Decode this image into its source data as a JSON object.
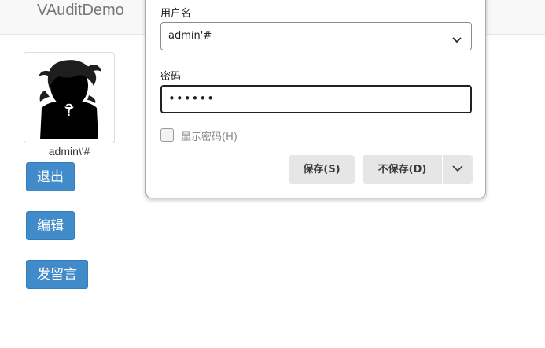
{
  "navbar": {
    "brand": "VAuditDemo"
  },
  "profile": {
    "avatar_glyph": "?",
    "username": "admin\\'#"
  },
  "actions": {
    "logout_label": "退出",
    "edit_label": "编辑",
    "post_label": "发留言"
  },
  "password_popup": {
    "username_label": "用户名",
    "username_value": "admin'#",
    "password_label": "密码",
    "password_value": "••••••",
    "show_password_label": "显示密码(H)",
    "save_label": "保存(S)",
    "no_save_label": "不保存(D)"
  },
  "colors": {
    "accent": "#428bca",
    "navbar_bg": "#f8f8f8",
    "popup_button_bg": "#e6e6e6"
  },
  "icons": {
    "username_dropdown": "chevron-down-icon",
    "more_options": "chevron-down-icon"
  }
}
